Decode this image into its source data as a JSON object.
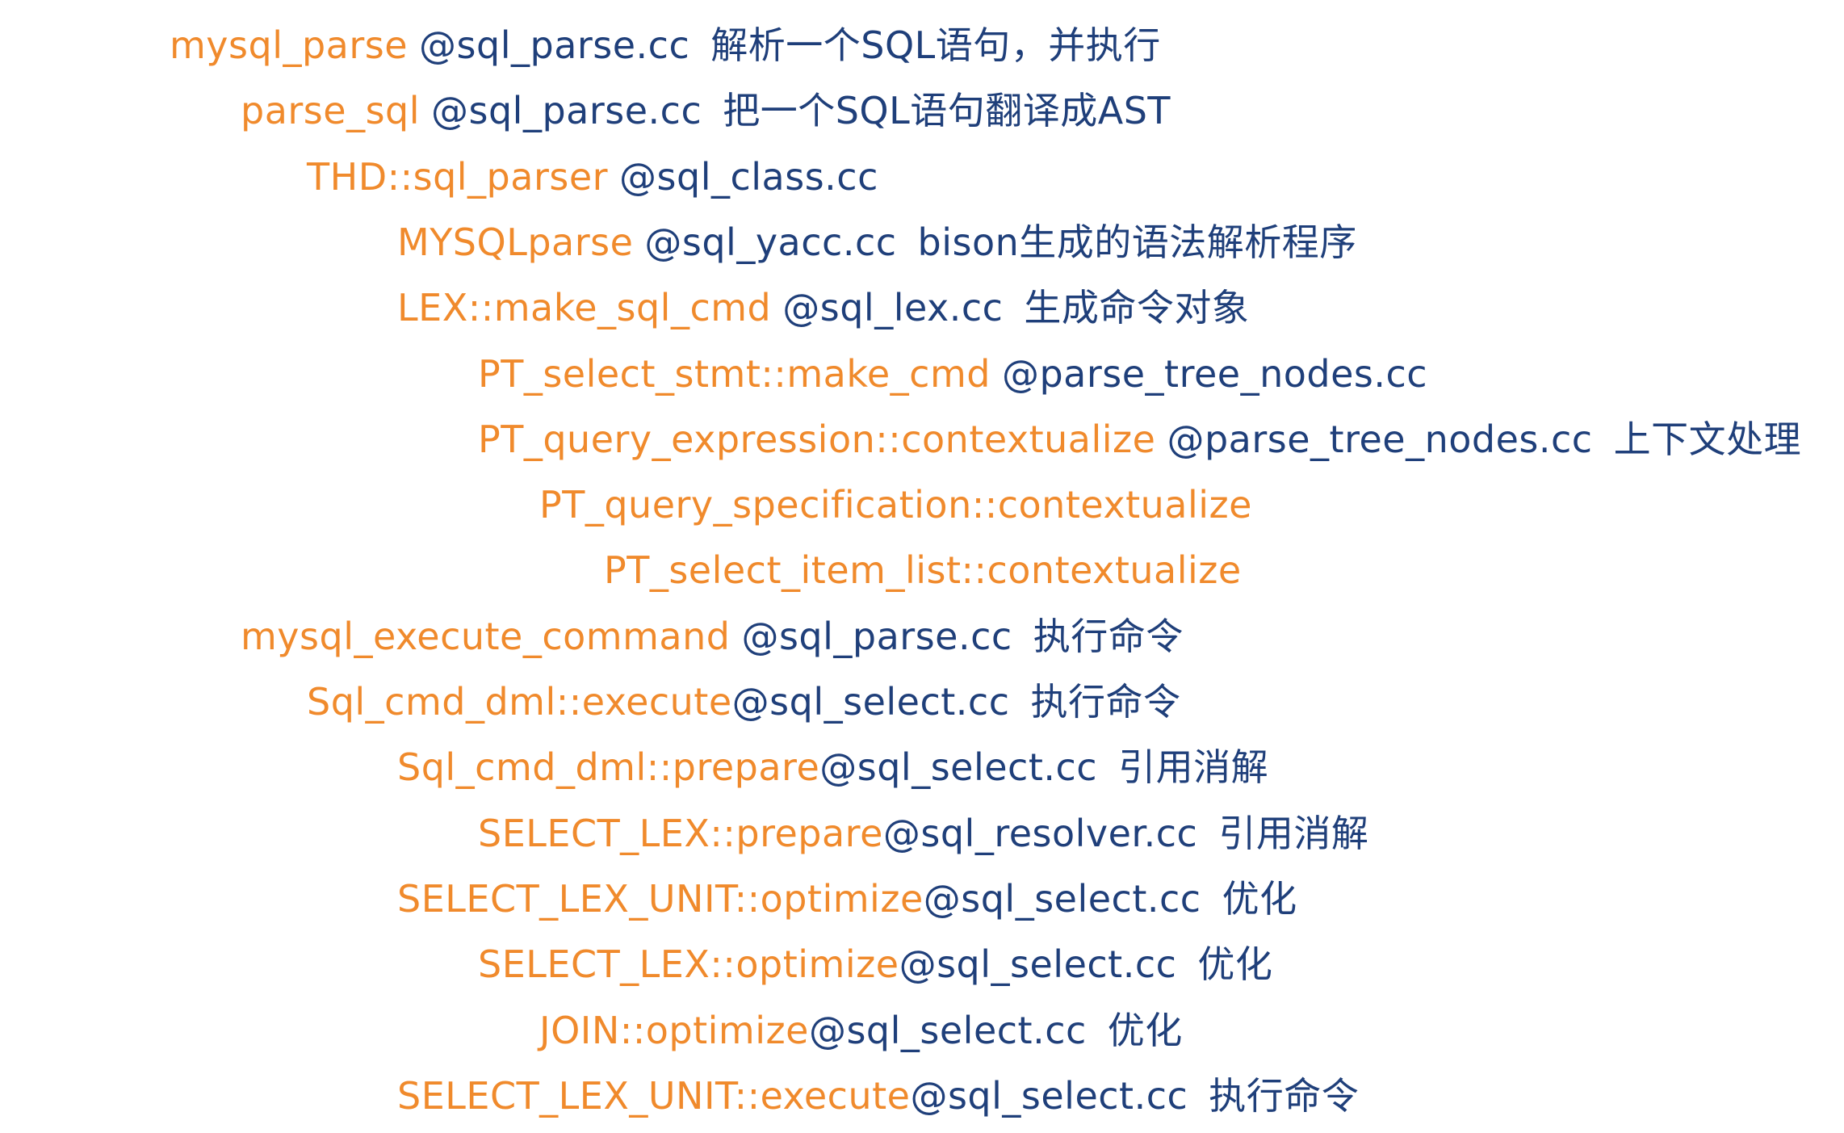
{
  "colors": {
    "function": "#f08a2c",
    "file_and_description": "#1f3f7a",
    "background": "#ffffff"
  },
  "rows": [
    {
      "fn": "mysql_parse",
      "file": "@sql_parse.cc",
      "desc": "解析一个SQL语句，并执行",
      "depth": 0
    },
    {
      "fn": "parse_sql",
      "file": "@sql_parse.cc",
      "desc": "把一个SQL语句翻译成AST",
      "depth": 1
    },
    {
      "fn": "THD::sql_parser",
      "file": "@sql_class.cc",
      "desc": "",
      "depth": 2
    },
    {
      "fn": "MYSQLparse",
      "file": "@sql_yacc.cc",
      "desc": "bison生成的语法解析程序",
      "depth": 3
    },
    {
      "fn": "LEX::make_sql_cmd",
      "file": "@sql_lex.cc",
      "desc": "生成命令对象",
      "depth": 3
    },
    {
      "fn": "PT_select_stmt::make_cmd",
      "file": "@parse_tree_nodes.cc",
      "desc": "",
      "depth": 4
    },
    {
      "fn": "PT_query_expression::contextualize",
      "file": "@parse_tree_nodes.cc",
      "desc": "上下文处理",
      "depth": 4
    },
    {
      "fn": "PT_query_specification::contextualize",
      "file": "",
      "desc": "",
      "depth": 5
    },
    {
      "fn": "PT_select_item_list::contextualize",
      "file": "",
      "desc": "",
      "depth": 6
    },
    {
      "fn": "mysql_execute_command",
      "file": "@sql_parse.cc",
      "desc": "执行命令",
      "depth": 1
    },
    {
      "fn": "Sql_cmd_dml::execute",
      "file": "@sql_select.cc",
      "desc": "执行命令",
      "depth": 2,
      "tight": true
    },
    {
      "fn": "Sql_cmd_dml::prepare",
      "file": "@sql_select.cc",
      "desc": "引用消解",
      "depth": 3,
      "tight": true
    },
    {
      "fn": "SELECT_LEX::prepare",
      "file": "@sql_resolver.cc",
      "desc": "引用消解",
      "depth": 4,
      "tight": true
    },
    {
      "fn": "SELECT_LEX_UNIT::optimize",
      "file": "@sql_select.cc",
      "desc": "优化",
      "depth": 3,
      "tight": true
    },
    {
      "fn": "SELECT_LEX::optimize",
      "file": "@sql_select.cc",
      "desc": "优化",
      "depth": 4,
      "tight": true
    },
    {
      "fn": "JOIN::optimize",
      "file": "@sql_select.cc",
      "desc": "优化",
      "depth": 5,
      "tight": true
    },
    {
      "fn": "SELECT_LEX_UNIT::execute",
      "file": "@sql_select.cc",
      "desc": "执行命令",
      "depth": 3,
      "tight": true
    }
  ]
}
